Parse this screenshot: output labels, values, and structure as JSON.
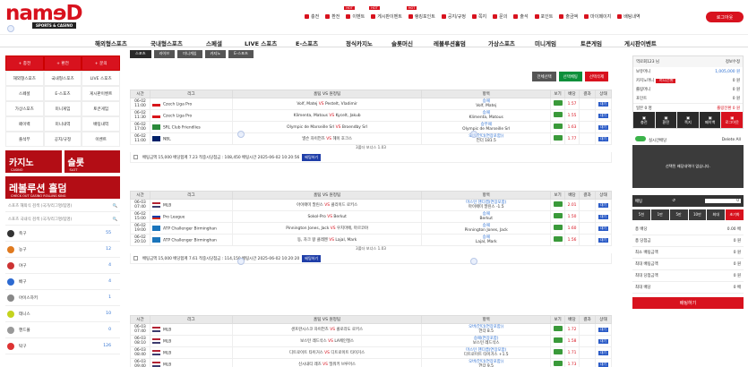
{
  "logo": {
    "main": "namɘD",
    "sub": "SPORTS & CASINO"
  },
  "topnav": [
    {
      "label": "충전",
      "hot": false
    },
    {
      "label": "환전",
      "hot": false
    },
    {
      "label": "이벤트",
      "hot": true
    },
    {
      "label": "게시판이벤트",
      "hot": true
    },
    {
      "label": "랭킹포인트",
      "hot": true
    },
    {
      "label": "공지/규정",
      "hot": false
    },
    {
      "label": "쪽지",
      "hot": false
    },
    {
      "label": "문의",
      "hot": false
    },
    {
      "label": "출석",
      "hot": false
    },
    {
      "label": "포인트",
      "hot": false
    },
    {
      "label": "출금액",
      "hot": false
    },
    {
      "label": "마이페이지",
      "hot": false
    },
    {
      "label": "배팅내역",
      "hot": false
    }
  ],
  "hot_label": "HOT",
  "login": "로그아웃",
  "mainnav": [
    "해외형스포츠",
    "국내형스포츠",
    "스페셜",
    "LIVE 스포츠",
    "E-스포츠",
    "정식카지노",
    "슬롯머신",
    "레볼루션홀덤",
    "가상스포츠",
    "미니게임",
    "토큰게임",
    "게시판이벤트"
  ],
  "left": {
    "quick": [
      "충전",
      "환전",
      "문의"
    ],
    "menu": [
      "해외형스포츠",
      "국내형스포츠",
      "LIVE 스포츠",
      "스페셜",
      "E-스포츠",
      "게시판이벤트",
      "가상스포츠",
      "미니게임",
      "토큰게임",
      "페이백",
      "미니내역",
      "배팅내역",
      "출석부",
      "공지/규정",
      "이벤트"
    ],
    "banners": {
      "casino": "카지노",
      "casino_sub": "CASINO",
      "slot": "슬롯",
      "slot_sub": "SLOT",
      "holdem": "레볼루션 홀덤",
      "holdem_sub": "CHECK OUT CASINO ROLLING KING"
    },
    "search1": "스포츠 해외식 검색 (국가/리그명/팀명)",
    "search2": "스포츠 국내식 검색 (국가/리그명/팀명)",
    "sports": [
      {
        "name": "축구",
        "count": "55",
        "color": "#333"
      },
      {
        "name": "농구",
        "count": "12",
        "color": "#e07a1f"
      },
      {
        "name": "야구",
        "count": "4",
        "color": "#c33"
      },
      {
        "name": "배구",
        "count": "4",
        "color": "#2d6ad1"
      },
      {
        "name": "아이스하키",
        "count": "1",
        "color": "#888"
      },
      {
        "name": "테니스",
        "count": "10",
        "color": "#c4d31e"
      },
      {
        "name": "핸드볼",
        "count": "0",
        "color": "#999"
      },
      {
        "name": "탁구",
        "count": "126",
        "color": "#d33"
      }
    ]
  },
  "center": {
    "subtabs": [
      "스포츠",
      "라이브",
      "미니게임",
      "카지노",
      "E-스포츠"
    ],
    "select_btns": [
      {
        "label": "전체선택",
        "color": "#555"
      },
      {
        "label": "선택베팅",
        "color": "#0b8f3a"
      },
      {
        "label": "선택삭제",
        "color": "#d8121e"
      }
    ],
    "headers": [
      "시간",
      "리그",
      "홈팀 VS 원정팀",
      "항목",
      "보기",
      "배당",
      "결과",
      "상태"
    ],
    "status_label": "대기",
    "vs": "VS",
    "bet_btn": "베팅하기",
    "groups": [
      {
        "rows": [
          {
            "date": "06-02",
            "time": "11:00",
            "flag": "cz",
            "league": "Czech Liga Pro",
            "home": "Volf, Matej",
            "away": "Pestelt, Vladimir",
            "item1": "승패",
            "item2": "Volf, Matej",
            "odd": "1.57"
          },
          {
            "date": "06-02",
            "time": "11:30",
            "flag": "cz",
            "league": "Czech Liga Pro",
            "home": "Klimenta, Matous",
            "away": "Kycelt, Jakub",
            "item1": "승패",
            "item2": "Klimenta, Matous",
            "odd": "1.55"
          },
          {
            "date": "06-02",
            "time": "17:00",
            "flag": "soc",
            "league": "SRL Club Friendlies",
            "home": "Olympic de Marseille Srl",
            "away": "Broendby Srl",
            "item1": "승무패",
            "item2": "Olympic de Marseille Srl",
            "odd": "1.63"
          },
          {
            "date": "06-02",
            "time": "11:00",
            "flag": "nz",
            "league": "NBL",
            "home": "넬슨 자이언츠",
            "away": "헤이 호크스",
            "item1": "오버(언더(연장포함))",
            "item2": "언더 181.5",
            "odd": "1.77"
          }
        ],
        "footer": "3폴더 보너스 1.03",
        "summary": "배팅금액 15,000 배당합계 7.23 적중시당첨금 : 108,450 배팅시간 2025-06-02 10:20:56"
      },
      {
        "rows": [
          {
            "date": "06-03",
            "time": "07:40",
            "flag": "us",
            "league": "MLB",
            "home": "아이애미 말린스",
            "away": "클리이드 로키스",
            "item1": "마스턴 핸디캡(연장포함)",
            "item2": "마이애미 말린스 -1.5",
            "odd": "2.01"
          },
          {
            "date": "06-02",
            "time": "15:00",
            "flag": "ru",
            "league": "Pro League",
            "home": "Sokol-Pro",
            "away": "Berkut",
            "item1": "승패",
            "item2": "Berkut",
            "odd": "1.50"
          },
          {
            "date": "06-02",
            "time": "19:00",
            "flag": "atp",
            "league": "ATP Challenger Birminghan",
            "home": "Pinnington Jones, Jack",
            "away": "우치마에, 마르코야",
            "item1": "승패",
            "item2": "Pinnington Jones, Jack",
            "odd": "1.60"
          },
          {
            "date": "06-02",
            "time": "20:10",
            "flag": "atp",
            "league": "ATP Challenger Birminghan",
            "home": "동, 자크 왕 클레멘",
            "away": "Lajal, Mark",
            "item1": "승패",
            "item2": "Lajal, Mark",
            "odd": "1.56"
          }
        ],
        "footer": "3폴더 보너스 1.03",
        "summary": "배팅금액 15,000 배당합계 7.61 적중시당첨금 : 114,150 배팅시간 2025-06-02 10:20:20"
      },
      {
        "rows": [
          {
            "date": "06-03",
            "time": "07:40",
            "flag": "us",
            "league": "MLB",
            "home": "샌프란시스코 자이언츠",
            "away": "콜로라도 로키스",
            "item1": "오버(언더(연장포함))",
            "item2": "언더 8.5",
            "odd": "1.72"
          },
          {
            "date": "06-03",
            "time": "08:10",
            "flag": "us",
            "league": "MLB",
            "home": "보스턴 레드삭스",
            "away": "LA에인절스",
            "item1": "승패(연장포함)",
            "item2": "보스턴 레드삭스",
            "odd": "1.58"
          },
          {
            "date": "06-03",
            "time": "08:40",
            "flag": "us",
            "league": "MLB",
            "home": "디트로이트 타이거스",
            "away": "디트로이트 타이거스",
            "item1": "마스턴 핸디캡(연장포함)",
            "item2": "디트로이트 타이거스 +1.5",
            "odd": "1.71"
          },
          {
            "date": "06-03",
            "time": "09:40",
            "flag": "us",
            "league": "MLB",
            "home": "신시내티 레즈",
            "away": "밀워키 브루어스",
            "item1": "오버(언더(연장포함))",
            "item2": "언더 9.5",
            "odd": "1.73"
          }
        ],
        "footer": "",
        "summary": "배팅금액 15,000 배당합계 8.03 적중시당첨금 : 120,449 배팅시간 2025-06-02 10:19:33"
      }
    ]
  },
  "right": {
    "user": "역로회123 님",
    "profile": "정보수정",
    "rows": [
      {
        "k": "보유머니",
        "v": "1,005,000 원"
      },
      {
        "k": "카지노머니",
        "v": "0 원"
      },
      {
        "k": "롤링머니",
        "v": "0 원"
      },
      {
        "k": "포인트",
        "v": "0 원"
      }
    ],
    "tag": "머니전환",
    "daily": "일본 0 명",
    "rolling": "롤링전환 0 원",
    "quick": [
      "충전",
      "환전",
      "쪽지",
      "페이백",
      "로그아웃"
    ],
    "toggle_label": "실시간배당",
    "delete": "Delete All",
    "slip_msg": "선택된 배당내역이 없습니다.",
    "bet_label": "배팅",
    "bet_amount": "0",
    "amounts": [
      "5천",
      "1만",
      "5만",
      "10만",
      "최대",
      "초기화"
    ],
    "summary": [
      {
        "k": "총 배당",
        "v": "0.00 배"
      },
      {
        "k": "총 당첨금",
        "v": "0 원"
      },
      {
        "k": "최소 배팅금액",
        "v": "0 원"
      },
      {
        "k": "최대 배팅금액",
        "v": "0 원"
      },
      {
        "k": "최대 당첨금액",
        "v": "0 원"
      },
      {
        "k": "최대 배당",
        "v": "0 배"
      }
    ],
    "bet_button": "배팅하기"
  }
}
